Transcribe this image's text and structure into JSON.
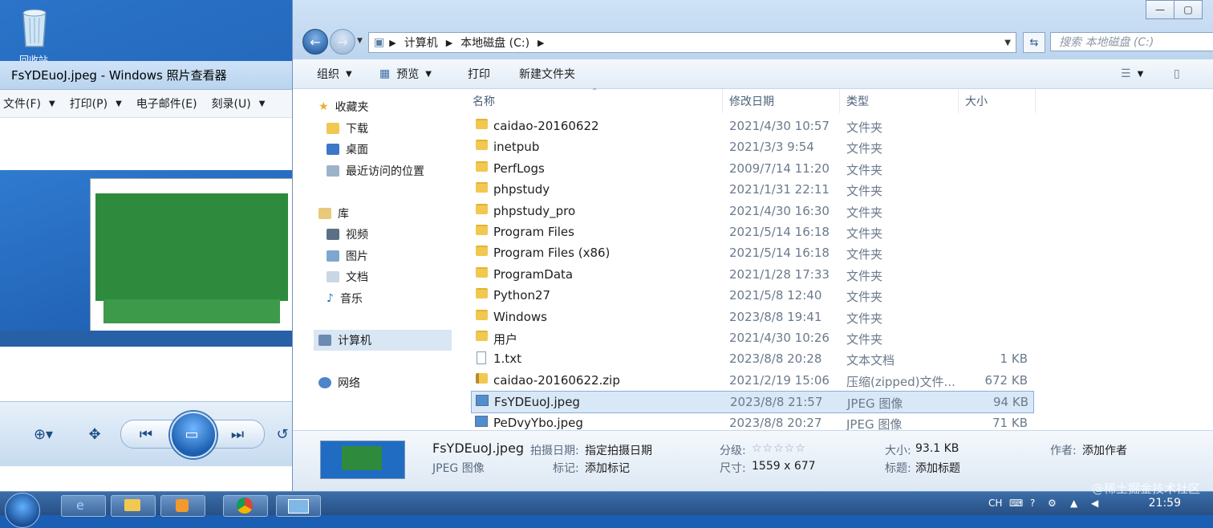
{
  "desktop": {
    "recycle_label": "回收站"
  },
  "viewer": {
    "title": "FsYDEuoJ.jpeg - Windows 照片查看器",
    "menu": [
      {
        "label": "文件(F)"
      },
      {
        "label": "打印(P)"
      },
      {
        "label": "电子邮件(E)"
      },
      {
        "label": "刻录(U)"
      }
    ]
  },
  "explorer": {
    "window_buttons": [
      "—",
      "▢"
    ],
    "address": {
      "segments": [
        "计算机",
        "本地磁盘 (C:)"
      ]
    },
    "search_placeholder": "搜索 本地磁盘 (C:)",
    "toolbar": {
      "organize": "组织",
      "preview": "预览",
      "print": "打印",
      "new_folder": "新建文件夹"
    },
    "nav": {
      "favorites": "收藏夹",
      "downloads": "下载",
      "desktop": "桌面",
      "recent": "最近访问的位置",
      "libraries": "库",
      "videos": "视频",
      "pictures": "图片",
      "documents": "文档",
      "music": "音乐",
      "computer": "计算机",
      "network": "网络"
    },
    "columns": {
      "name": "名称",
      "modified": "修改日期",
      "type": "类型",
      "size": "大小"
    },
    "files": [
      {
        "name": "caidao-20160622",
        "date": "2021/4/30 10:57",
        "type": "文件夹",
        "size": "",
        "icon": "folder"
      },
      {
        "name": "inetpub",
        "date": "2021/3/3 9:54",
        "type": "文件夹",
        "size": "",
        "icon": "folder"
      },
      {
        "name": "PerfLogs",
        "date": "2009/7/14 11:20",
        "type": "文件夹",
        "size": "",
        "icon": "folder"
      },
      {
        "name": "phpstudy",
        "date": "2021/1/31 22:11",
        "type": "文件夹",
        "size": "",
        "icon": "folder"
      },
      {
        "name": "phpstudy_pro",
        "date": "2021/4/30 16:30",
        "type": "文件夹",
        "size": "",
        "icon": "folder"
      },
      {
        "name": "Program Files",
        "date": "2021/5/14 16:18",
        "type": "文件夹",
        "size": "",
        "icon": "folder"
      },
      {
        "name": "Program Files (x86)",
        "date": "2021/5/14 16:18",
        "type": "文件夹",
        "size": "",
        "icon": "folder"
      },
      {
        "name": "ProgramData",
        "date": "2021/1/28 17:33",
        "type": "文件夹",
        "size": "",
        "icon": "folder"
      },
      {
        "name": "Python27",
        "date": "2021/5/8 12:40",
        "type": "文件夹",
        "size": "",
        "icon": "folder"
      },
      {
        "name": "Windows",
        "date": "2023/8/8 19:41",
        "type": "文件夹",
        "size": "",
        "icon": "folder"
      },
      {
        "name": "用户",
        "date": "2021/4/30 10:26",
        "type": "文件夹",
        "size": "",
        "icon": "folder"
      },
      {
        "name": "1.txt",
        "date": "2023/8/8 20:28",
        "type": "文本文档",
        "size": "1 KB",
        "icon": "text"
      },
      {
        "name": "caidao-20160622.zip",
        "date": "2021/2/19 15:06",
        "type": "压缩(zipped)文件...",
        "size": "672 KB",
        "icon": "zip"
      },
      {
        "name": "FsYDEuoJ.jpeg",
        "date": "2023/8/8 21:57",
        "type": "JPEG 图像",
        "size": "94 KB",
        "icon": "image"
      },
      {
        "name": "PeDvyYbo.jpeg",
        "date": "2023/8/8 20:27",
        "type": "JPEG 图像",
        "size": "71 KB",
        "icon": "image"
      }
    ],
    "details": {
      "filename": "FsYDEuoJ.jpeg",
      "filetype": "JPEG 图像",
      "date_label": "拍摄日期:",
      "date_value": "指定拍摄日期",
      "tags_label": "标记:",
      "tags_value": "添加标记",
      "rating_label": "分级:",
      "rating_value": "☆☆☆☆☆",
      "dims_label": "尺寸:",
      "dims_value": "1559 x 677",
      "size_label": "大小:",
      "size_value": "93.1 KB",
      "title_label": "标题:",
      "title_value": "添加标题",
      "author_label": "作者:",
      "author_value": "添加作者"
    }
  },
  "taskbar": {
    "lang": "CH",
    "time": "21:59"
  },
  "watermark": "@稀土掘金技术社区"
}
